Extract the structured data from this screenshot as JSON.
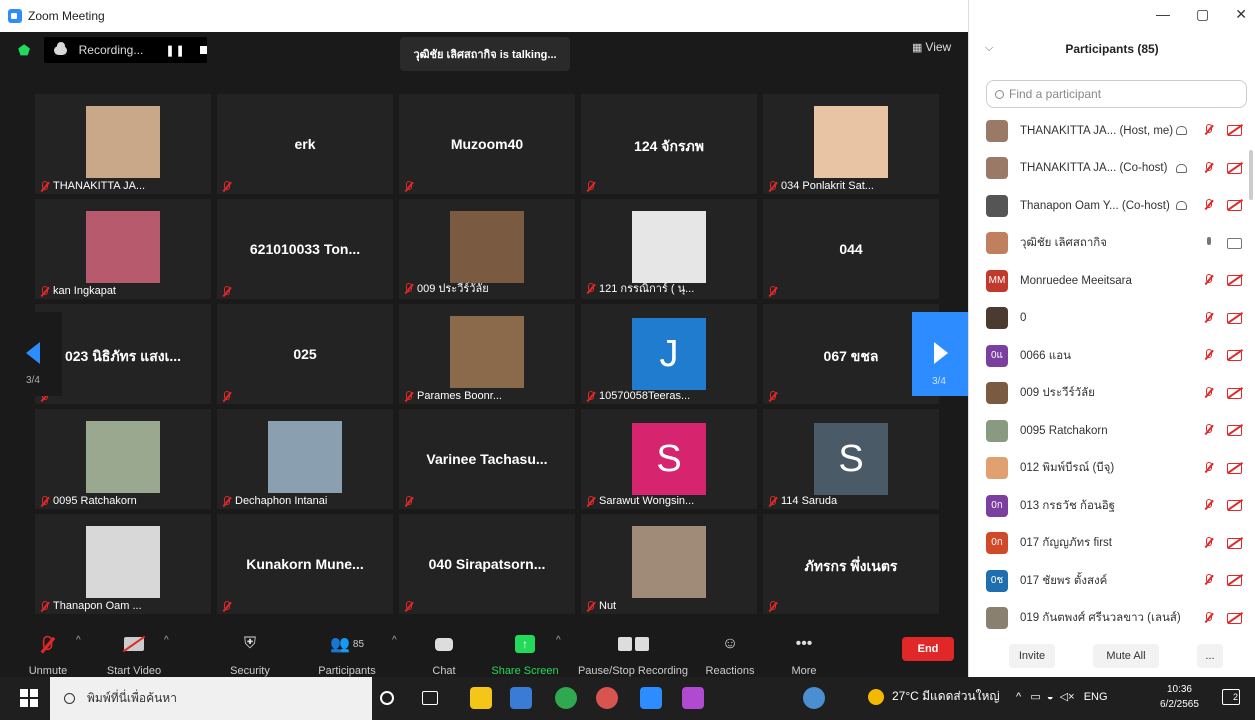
{
  "window": {
    "title": "Zoom Meeting",
    "controls": [
      "—",
      "▢",
      "✕"
    ]
  },
  "topbar": {
    "recording_label": "Recording...",
    "talking": "วุฒิชัย เลิศสถากิจ is talking...",
    "view_label": "View"
  },
  "pager": {
    "left": "3/4",
    "right": "3/4"
  },
  "tiles": [
    {
      "name": "",
      "label": "THANAKITTA  JA...",
      "kind": "photo",
      "color": "#c9a88a"
    },
    {
      "name": "erk",
      "label": "",
      "kind": "name"
    },
    {
      "name": "Muzoom40",
      "label": "",
      "kind": "name"
    },
    {
      "name": "124 จักรภพ",
      "label": "",
      "kind": "name"
    },
    {
      "name": "",
      "label": "034 Ponlakrit Sat...",
      "kind": "photo",
      "color": "#e8c4a4"
    },
    {
      "name": "",
      "label": "kan Ingkapat",
      "kind": "photo",
      "color": "#b85a6e"
    },
    {
      "name": "621010033 Ton...",
      "label": "",
      "kind": "name"
    },
    {
      "name": "",
      "label": "009 ประวีร์วัลัย",
      "kind": "photo",
      "color": "#7a5a40"
    },
    {
      "name": "",
      "label": "121 กรรณิการ์ ( นุ...",
      "kind": "photo",
      "color": "#e6e6e6"
    },
    {
      "name": "044",
      "label": "",
      "kind": "name"
    },
    {
      "name": "023 นิธิภัทร แสงเ...",
      "label": "",
      "kind": "name"
    },
    {
      "name": "025",
      "label": "",
      "kind": "name"
    },
    {
      "name": "",
      "label": "Parames  Boonr...",
      "kind": "photo",
      "color": "#8a6a4a"
    },
    {
      "name": "J",
      "label": "10570058Teeras...",
      "kind": "avatar",
      "color": "#1f7ccf"
    },
    {
      "name": "067 ขชล",
      "label": "",
      "kind": "name"
    },
    {
      "name": "",
      "label": "0095 Ratchakorn",
      "kind": "photo",
      "color": "#9aa890"
    },
    {
      "name": "",
      "label": "Dechaphon Intanai",
      "kind": "photo",
      "color": "#8aa0b0"
    },
    {
      "name": "Varinee  Tachasu...",
      "label": "",
      "kind": "name"
    },
    {
      "name": "S",
      "label": "Sarawut Wongsin...",
      "kind": "avatar",
      "color": "#d6246e"
    },
    {
      "name": "S",
      "label": "114 Saruda",
      "kind": "avatar",
      "color": "#4a5a66"
    },
    {
      "name": "",
      "label": "Thanapon Oam ...",
      "kind": "photo",
      "color": "#d8d8d8"
    },
    {
      "name": "Kunakorn  Mune...",
      "label": "",
      "kind": "name"
    },
    {
      "name": "040  Sirapatsorn...",
      "label": "",
      "kind": "name"
    },
    {
      "name": "",
      "label": "Nut",
      "kind": "photo",
      "color": "#a08a78"
    },
    {
      "name": "ภัทรกร พึ่งเนตร",
      "label": "",
      "kind": "name"
    }
  ],
  "toolbar": {
    "unmute": "Unmute",
    "start_video": "Start Video",
    "security": "Security",
    "participants": "Participants",
    "participants_count": "85",
    "chat": "Chat",
    "share_screen": "Share Screen",
    "pause_recording": "Pause/Stop Recording",
    "reactions": "Reactions",
    "more": "More",
    "end": "End"
  },
  "panel": {
    "title": "Participants (85)",
    "search_placeholder": "Find a participant",
    "invite": "Invite",
    "mute_all": "Mute All",
    "more": "...",
    "participants": [
      {
        "name": "THANAKITTA  JA...  (Host, me)",
        "avatar": "",
        "color": "#9a7a66",
        "cc": true,
        "audio": "muted",
        "video": "off"
      },
      {
        "name": "THANAKITTA  JA...  (Co-host)",
        "avatar": "",
        "color": "#9a7a66",
        "cc": true,
        "audio": "muted",
        "video": "off"
      },
      {
        "name": "Thanapon Oam Y...  (Co-host)",
        "avatar": "",
        "color": "#555555",
        "cc": true,
        "audio": "muted",
        "video": "off"
      },
      {
        "name": "วุฒิชัย เลิศสถากิจ",
        "avatar": "",
        "color": "#c08060",
        "cc": false,
        "audio": "on",
        "video": "on"
      },
      {
        "name": "Monruedee Meeitsara",
        "avatar": "MM",
        "color": "#c0392b",
        "cc": false,
        "audio": "muted",
        "video": "off"
      },
      {
        "name": "0",
        "avatar": "",
        "color": "#4a3a30",
        "cc": false,
        "audio": "muted",
        "video": "off"
      },
      {
        "name": "0066 แอน",
        "avatar": "0แ",
        "color": "#7b3fa0",
        "cc": false,
        "audio": "muted",
        "video": "off"
      },
      {
        "name": "009 ประวีร์วัลัย",
        "avatar": "",
        "color": "#7a5a40",
        "cc": false,
        "audio": "muted",
        "video": "off"
      },
      {
        "name": "0095 Ratchakorn",
        "avatar": "",
        "color": "#8a9a80",
        "cc": false,
        "audio": "muted",
        "video": "off"
      },
      {
        "name": "012 พิมพ์บีรณ์ (บีจุ)",
        "avatar": "",
        "color": "#e0a070",
        "cc": false,
        "audio": "muted",
        "video": "off"
      },
      {
        "name": "013 กรธวัช ก้อนอิฐ",
        "avatar": "0ก",
        "color": "#7b3fa0",
        "cc": false,
        "audio": "muted",
        "video": "off"
      },
      {
        "name": "017 กัญญภัทร first",
        "avatar": "0ก",
        "color": "#d04a2a",
        "cc": false,
        "audio": "muted",
        "video": "off"
      },
      {
        "name": "017 ชัยพร ตั้งสงค์",
        "avatar": "0ช",
        "color": "#1f6fb0",
        "cc": false,
        "audio": "muted",
        "video": "off"
      },
      {
        "name": "019 กันตพงศ์ ศรีนวลขาว (เลนส์)",
        "avatar": "",
        "color": "#8a8070",
        "cc": false,
        "audio": "muted",
        "video": "off"
      }
    ]
  },
  "taskbar": {
    "search_placeholder": "พิมพ์ที่นี่เพื่อค้นหา",
    "weather": "27°C  มีแดดส่วนใหญ่",
    "lang": "ENG",
    "time": "10:36",
    "date": "6/2/2565",
    "notifications": "2",
    "app_colors": [
      "#f5c518",
      "#3a7bd5",
      "#2fa84f",
      "#d9534f",
      "#2d8cff",
      "#b04ad0",
      "#4a90d0"
    ]
  }
}
